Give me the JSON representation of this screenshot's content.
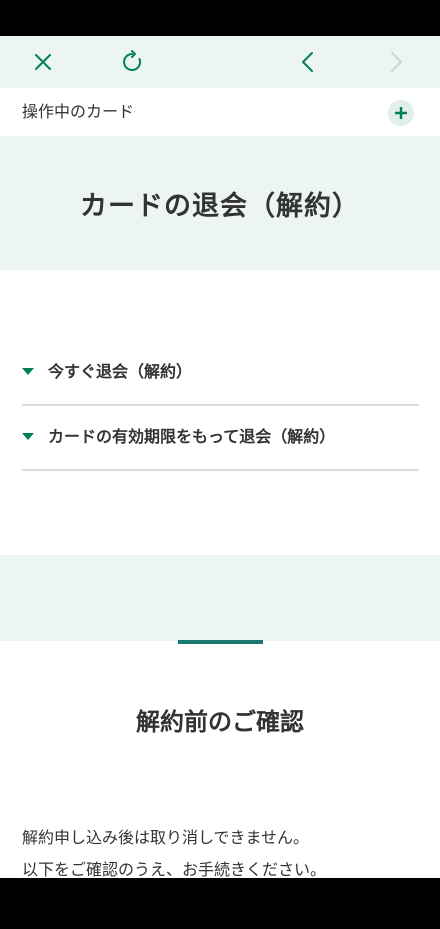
{
  "toolbar": {
    "close_icon": "close-icon",
    "reload_icon": "reload-icon",
    "back_icon": "chevron-left-icon",
    "forward_icon": "chevron-right-icon",
    "accent_color": "#00805a",
    "disabled_color": "#c8d6d0"
  },
  "card_bar": {
    "label": "操作中のカード",
    "add_icon": "plus-icon"
  },
  "hero": {
    "title": "カードの退会（解約）"
  },
  "accordion": {
    "items": [
      {
        "label": "今すぐ退会（解約）"
      },
      {
        "label": "カードの有効期限をもって退会（解約）"
      }
    ]
  },
  "confirmation": {
    "title": "解約前のご確認",
    "lines": [
      "解約申し込み後は取り消しできません。",
      "以下をご確認のうえ、お手続きください。"
    ]
  }
}
